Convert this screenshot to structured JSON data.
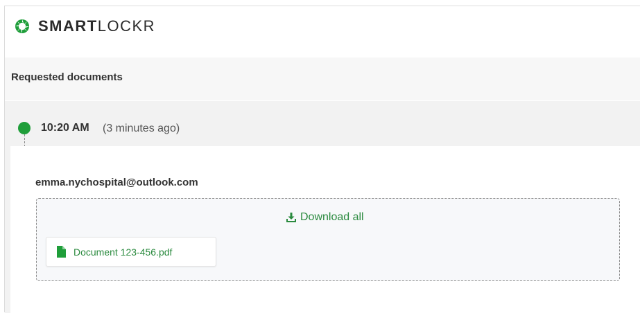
{
  "brand": {
    "name_bold": "SMART",
    "name_light": "LOCKR",
    "color": "#1f9e3a"
  },
  "section": {
    "title": "Requested documents"
  },
  "timeline": {
    "time": "10:20 AM",
    "relative": "(3 minutes ago)",
    "sender": "emma.nychospital@outlook.com",
    "download_all_label": "Download all",
    "files": [
      {
        "name": "Document 123-456.pdf",
        "icon": "file-icon"
      }
    ]
  },
  "colors": {
    "accent": "#1f9e3a",
    "link": "#2a8a3e"
  }
}
